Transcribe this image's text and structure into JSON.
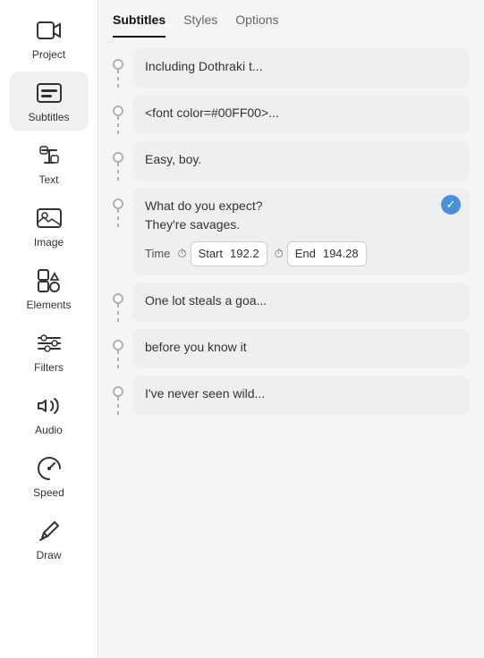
{
  "sidebar": {
    "items": [
      {
        "id": "project",
        "label": "Project",
        "icon": "video"
      },
      {
        "id": "subtitles",
        "label": "Subtitles",
        "icon": "subtitles",
        "active": true
      },
      {
        "id": "text",
        "label": "Text",
        "icon": "text"
      },
      {
        "id": "image",
        "label": "Image",
        "icon": "image"
      },
      {
        "id": "elements",
        "label": "Elements",
        "icon": "elements"
      },
      {
        "id": "filters",
        "label": "Filters",
        "icon": "filters"
      },
      {
        "id": "audio",
        "label": "Audio",
        "icon": "audio"
      },
      {
        "id": "speed",
        "label": "Speed",
        "icon": "speed"
      },
      {
        "id": "draw",
        "label": "Draw",
        "icon": "draw"
      }
    ]
  },
  "tabs": [
    {
      "id": "subtitles",
      "label": "Subtitles",
      "active": true
    },
    {
      "id": "styles",
      "label": "Styles",
      "active": false
    },
    {
      "id": "options",
      "label": "Options",
      "active": false
    }
  ],
  "subtitles": [
    {
      "id": 1,
      "text": "Including Dothraki t...",
      "selected": false
    },
    {
      "id": 2,
      "text": "<font color=#00FF00>...",
      "selected": false
    },
    {
      "id": 3,
      "text": "Easy, boy.",
      "selected": false
    },
    {
      "id": 4,
      "text": "What do you expect?\nThey're savages.",
      "selected": true,
      "time_start": "192.2",
      "time_end": "194.28"
    },
    {
      "id": 5,
      "text": "One lot steals a goa...",
      "selected": false
    },
    {
      "id": 6,
      "text": "before you know it",
      "selected": false
    },
    {
      "id": 7,
      "text": "I've never seen wild...",
      "selected": false
    }
  ],
  "time": {
    "label": "Time",
    "start_label": "Start",
    "end_label": "End",
    "start_value": "192.2",
    "end_value": "194.28"
  }
}
